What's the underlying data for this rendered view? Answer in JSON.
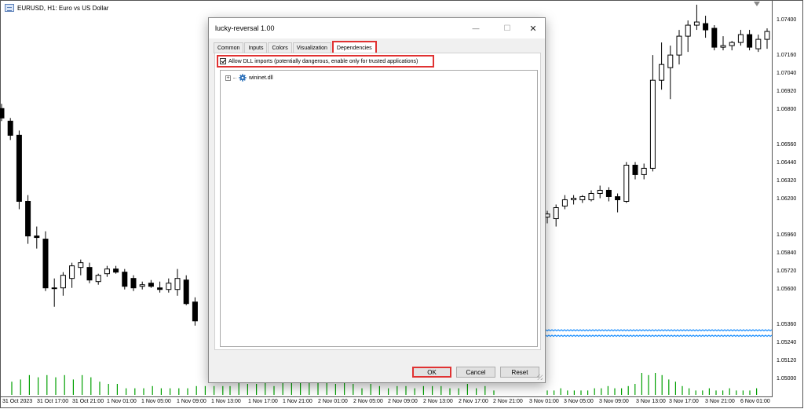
{
  "chart": {
    "title": "EURUSD, H1:  Euro vs US Dollar",
    "symbol_icon": "chart-icon",
    "colors": {
      "bull_body": "#ffffff",
      "bear_body": "#000000",
      "candle_outline": "#000000",
      "volume": "#00a000",
      "indicator_line": "#1e90ff",
      "border": "#555555"
    },
    "price_labels": [
      "1.07400",
      "1.07160",
      "1.07040",
      "1.06920",
      "1.06800",
      "1.06560",
      "1.06440",
      "1.06320",
      "1.06200",
      "1.05960",
      "1.05840",
      "1.05720",
      "1.05600",
      "1.05360",
      "1.05240",
      "1.05120",
      "1.05000"
    ],
    "time_labels": [
      "31 Oct 2023",
      "31 Oct 17:00",
      "31 Oct 21:00",
      "1 Nov 01:00",
      "1 Nov 05:00",
      "1 Nov 09:00",
      "1 Nov 13:00",
      "1 Nov 17:00",
      "1 Nov 21:00",
      "2 Nov 01:00",
      "2 Nov 05:00",
      "2 Nov 09:00",
      "2 Nov 13:00",
      "2 Nov 17:00",
      "2 Nov 21:00",
      "3 Nov 01:00",
      "3 Nov 05:00",
      "3 Nov 09:00",
      "3 Nov 13:00",
      "3 Nov 17:00",
      "3 Nov 21:00",
      "6 Nov 01:00"
    ]
  },
  "chart_data": {
    "type": "candlestick",
    "ylim": [
      1.0495,
      1.0752
    ],
    "left_candles": [
      {
        "o": 1.0684,
        "h": 1.0687,
        "l": 1.0676,
        "c": 1.0678
      },
      {
        "o": 1.0676,
        "h": 1.0678,
        "l": 1.0664,
        "c": 1.0667
      },
      {
        "o": 1.0667,
        "h": 1.067,
        "l": 1.062,
        "c": 1.0625
      },
      {
        "o": 1.0625,
        "h": 1.0629,
        "l": 1.0598,
        "c": 1.0603
      },
      {
        "o": 1.0603,
        "h": 1.0609,
        "l": 1.0595,
        "c": 1.0602
      },
      {
        "o": 1.0601,
        "h": 1.0606,
        "l": 1.0568,
        "c": 1.057
      },
      {
        "o": 1.057,
        "h": 1.0576,
        "l": 1.0558,
        "c": 1.057
      },
      {
        "o": 1.057,
        "h": 1.058,
        "l": 1.0565,
        "c": 1.0578
      },
      {
        "o": 1.0576,
        "h": 1.0586,
        "l": 1.057,
        "c": 1.0584
      },
      {
        "o": 1.0583,
        "h": 1.0588,
        "l": 1.0578,
        "c": 1.0586
      },
      {
        "o": 1.0583,
        "h": 1.0586,
        "l": 1.0573,
        "c": 1.0575
      },
      {
        "o": 1.0574,
        "h": 1.0579,
        "l": 1.0572,
        "c": 1.0578
      },
      {
        "o": 1.0579,
        "h": 1.0584,
        "l": 1.0577,
        "c": 1.0582
      },
      {
        "o": 1.0582,
        "h": 1.0584,
        "l": 1.0579,
        "c": 1.058
      },
      {
        "o": 1.058,
        "h": 1.0582,
        "l": 1.0569,
        "c": 1.0571
      },
      {
        "o": 1.0576,
        "h": 1.0578,
        "l": 1.0568,
        "c": 1.057
      },
      {
        "o": 1.0571,
        "h": 1.0574,
        "l": 1.0569,
        "c": 1.0572
      },
      {
        "o": 1.0573,
        "h": 1.0575,
        "l": 1.057,
        "c": 1.0571
      },
      {
        "o": 1.057,
        "h": 1.0574,
        "l": 1.0567,
        "c": 1.0569
      },
      {
        "o": 1.0569,
        "h": 1.0576,
        "l": 1.0567,
        "c": 1.0573
      },
      {
        "o": 1.0569,
        "h": 1.0582,
        "l": 1.0565,
        "c": 1.0576
      },
      {
        "o": 1.0575,
        "h": 1.0578,
        "l": 1.0559,
        "c": 1.056
      },
      {
        "o": 1.0561,
        "h": 1.0564,
        "l": 1.0546,
        "c": 1.0549
      }
    ],
    "right_candles": [
      {
        "o": 1.0615,
        "h": 1.0619,
        "l": 1.0611,
        "c": 1.0617
      },
      {
        "o": 1.0614,
        "h": 1.0623,
        "l": 1.0609,
        "c": 1.0621
      },
      {
        "o": 1.0622,
        "h": 1.0629,
        "l": 1.062,
        "c": 1.0626
      },
      {
        "o": 1.0626,
        "h": 1.0629,
        "l": 1.0623,
        "c": 1.0627
      },
      {
        "o": 1.0626,
        "h": 1.0629,
        "l": 1.0624,
        "c": 1.0628
      },
      {
        "o": 1.0626,
        "h": 1.0632,
        "l": 1.0625,
        "c": 1.063
      },
      {
        "o": 1.063,
        "h": 1.0635,
        "l": 1.0627,
        "c": 1.0632
      },
      {
        "o": 1.0632,
        "h": 1.0634,
        "l": 1.0625,
        "c": 1.0628
      },
      {
        "o": 1.0628,
        "h": 1.063,
        "l": 1.0618,
        "c": 1.0626
      },
      {
        "o": 1.0625,
        "h": 1.065,
        "l": 1.0624,
        "c": 1.0648
      },
      {
        "o": 1.0648,
        "h": 1.065,
        "l": 1.0639,
        "c": 1.0642
      },
      {
        "o": 1.0642,
        "h": 1.0649,
        "l": 1.0639,
        "c": 1.0646
      },
      {
        "o": 1.0646,
        "h": 1.0718,
        "l": 1.0644,
        "c": 1.0702
      },
      {
        "o": 1.0702,
        "h": 1.0726,
        "l": 1.0696,
        "c": 1.0712
      },
      {
        "o": 1.071,
        "h": 1.0724,
        "l": 1.069,
        "c": 1.0718
      },
      {
        "o": 1.0718,
        "h": 1.0734,
        "l": 1.0712,
        "c": 1.073
      },
      {
        "o": 1.073,
        "h": 1.074,
        "l": 1.072,
        "c": 1.0737
      },
      {
        "o": 1.0737,
        "h": 1.075,
        "l": 1.0734,
        "c": 1.0739
      },
      {
        "o": 1.0738,
        "h": 1.0743,
        "l": 1.0729,
        "c": 1.0734
      },
      {
        "o": 1.0735,
        "h": 1.0737,
        "l": 1.0721,
        "c": 1.0723
      },
      {
        "o": 1.0723,
        "h": 1.073,
        "l": 1.0721,
        "c": 1.0724
      },
      {
        "o": 1.0724,
        "h": 1.0727,
        "l": 1.0721,
        "c": 1.0726
      },
      {
        "o": 1.0726,
        "h": 1.0734,
        "l": 1.0724,
        "c": 1.0731
      },
      {
        "o": 1.0731,
        "h": 1.0734,
        "l": 1.0721,
        "c": 1.0723
      },
      {
        "o": 1.0722,
        "h": 1.0731,
        "l": 1.072,
        "c": 1.0728
      },
      {
        "o": 1.0728,
        "h": 1.0735,
        "l": 1.0722,
        "c": 1.0733
      }
    ],
    "volumes_left": [
      0.6,
      0.7,
      0.9,
      0.8,
      0.9,
      0.8,
      0.9,
      0.7,
      0.9,
      0.8,
      0.6,
      0.5,
      0.5,
      0.3,
      0.3,
      0.3,
      0.4,
      0.3,
      0.3,
      0.3,
      0.3,
      0.4,
      0.4,
      0.4,
      0.4
    ],
    "volumes_mid": [
      0.4,
      0.6,
      0.5,
      0.5,
      0.6,
      0.4,
      0.6,
      0.7,
      0.6,
      0.6,
      0.7,
      0.6,
      0.5,
      0.6,
      0.5,
      0.3,
      0.5,
      0.4,
      0.3,
      0.4,
      0.4,
      0.3,
      0.4,
      0.4,
      0.4,
      0.3,
      0.3,
      0.5,
      0.3,
      0.4,
      0.2
    ],
    "volumes_right": [
      0.2,
      0.2,
      0.3,
      0.2,
      0.2,
      0.2,
      0.2,
      0.3,
      0.3,
      0.4,
      0.3,
      0.3,
      0.4,
      0.5,
      1.0,
      0.9,
      1.0,
      0.9,
      0.7,
      0.6,
      0.4,
      0.3,
      0.2,
      0.2,
      0.3,
      0.2,
      0.2,
      0.3,
      0.2,
      0.2,
      0.2,
      0.3
    ]
  },
  "dialog": {
    "title": "lucky-reversal 1.00",
    "minimize_glyph": "—",
    "maximize_glyph": "☐",
    "close_glyph": "✕",
    "tabs": [
      "Common",
      "Inputs",
      "Colors",
      "Visualization",
      "Dependencies"
    ],
    "active_tab": "Dependencies",
    "allow_dll_label": "Allow DLL imports (potentially dangerous, enable only for trusted applications)",
    "allow_dll_checked": true,
    "tree_expander": "+",
    "tree_item": "wininet.dll",
    "tree_item_icon": "gear-icon",
    "ok_label": "OK",
    "cancel_label": "Cancel",
    "reset_label": "Reset"
  }
}
